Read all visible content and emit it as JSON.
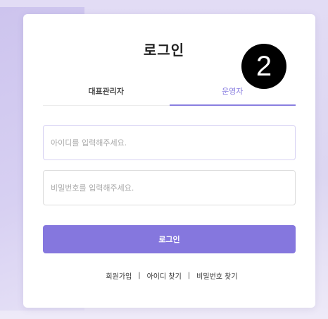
{
  "login": {
    "title": "로그인",
    "step_badge": "2",
    "tabs": [
      {
        "label": "대표관리자",
        "active": false
      },
      {
        "label": "운영자",
        "active": true
      }
    ],
    "id_placeholder": "아이디를 입력해주세요.",
    "password_placeholder": "비밀번호를 입력해주세요.",
    "submit_label": "로그인",
    "links": {
      "signup": "회원가입",
      "find_id": "아이디 찾기",
      "find_password": "비밀번호 찾기",
      "separator": "|"
    }
  },
  "colors": {
    "accent": "#8577de",
    "tab_active": "#8a7fe0",
    "background": "#dcd6f1"
  }
}
